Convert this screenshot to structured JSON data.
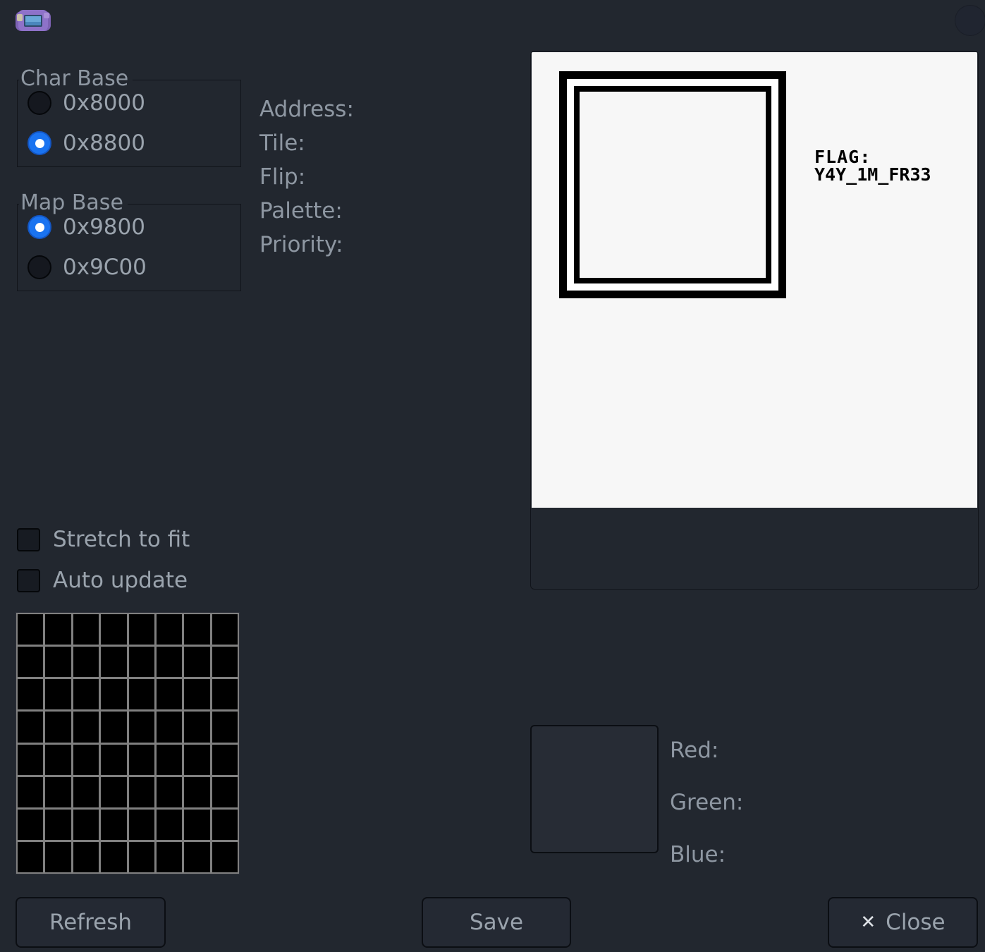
{
  "window": {
    "icon": "handheld-console-icon",
    "circle_button": "window-menu-button"
  },
  "char_base": {
    "title": "Char Base",
    "options": [
      {
        "label": "0x8000",
        "selected": false
      },
      {
        "label": "0x8800",
        "selected": true
      }
    ]
  },
  "map_base": {
    "title": "Map Base",
    "options": [
      {
        "label": "0x9800",
        "selected": true
      },
      {
        "label": "0x9C00",
        "selected": false
      }
    ]
  },
  "info": [
    {
      "label": "Address:",
      "value": ""
    },
    {
      "label": "Tile:",
      "value": ""
    },
    {
      "label": "Flip:",
      "value": ""
    },
    {
      "label": "Palette:",
      "value": ""
    },
    {
      "label": "Priority:",
      "value": ""
    }
  ],
  "options": [
    {
      "label": "Stretch to fit",
      "checked": false
    },
    {
      "label": "Auto update",
      "checked": false
    }
  ],
  "preview": {
    "flag_title": "FLAG:",
    "flag_value": "Y4Y_1M_FR33"
  },
  "color": {
    "swatch_hex": "#272c35",
    "channels": [
      {
        "label": "Red:",
        "value": ""
      },
      {
        "label": "Green:",
        "value": ""
      },
      {
        "label": "Blue:",
        "value": ""
      }
    ]
  },
  "buttons": {
    "refresh": "Refresh",
    "save": "Save",
    "close": "Close",
    "close_icon": "✕"
  },
  "theme": {
    "background": "#22272f",
    "accent": "#1a73f0",
    "text": "#9aa3ad",
    "canvas": "#f7f7f7"
  }
}
